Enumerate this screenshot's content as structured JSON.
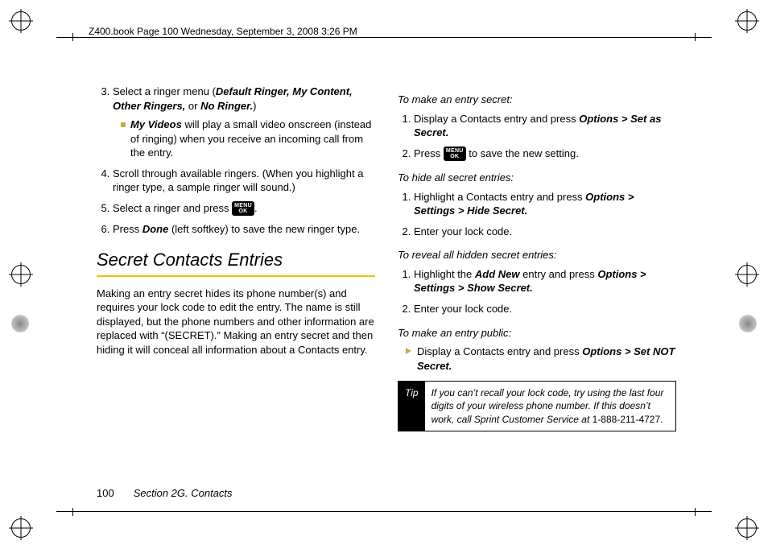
{
  "header": "Z400.book  Page 100  Wednesday, September 3, 2008  3:26 PM",
  "left": {
    "item3_lead": "Select a ringer menu (",
    "item3_opts": "Default Ringer, My Content, Other Ringers,",
    "item3_or": " or ",
    "item3_last": "No Ringer.",
    "item3_close": ")",
    "item3_sub_bold": "My Videos",
    "item3_sub_rest": " will play a small video onscreen (instead of ringing) when you receive an incoming call from the entry.",
    "item4": "Scroll through available ringers. (When you highlight a ringer type, a sample ringer will sound.)",
    "item5_a": "Select a ringer and press ",
    "item5_b": ".",
    "item6_a": "Press ",
    "item6_done": "Done",
    "item6_b": " (left softkey) to save the new ringer type.",
    "heading": "Secret Contacts Entries",
    "intro": "Making an entry secret hides its phone number(s) and requires your lock code to edit the entry. The name is still displayed, but the phone numbers and other information are replaced with “(SECRET).” Making an entry secret and then hiding it will conceal all information about a Contacts entry."
  },
  "right": {
    "task1": "To make an entry secret:",
    "t1_s1_a": "Display a Contacts entry and press ",
    "t1_s1_b": "Options > Set as Secret.",
    "t1_s2_a": "Press ",
    "t1_s2_b": " to save the new setting.",
    "task2": "To hide all secret entries:",
    "t2_s1_a": "Highlight a Contacts entry and press ",
    "t2_s1_b": "Options > Settings > Hide Secret.",
    "t2_s2": "Enter your lock code.",
    "task3": "To reveal all hidden secret entries:",
    "t3_s1_a": "Highlight the ",
    "t3_s1_bold": "Add New",
    "t3_s1_b": " entry and press ",
    "t3_s1_c": "Options > Settings > Show Secret.",
    "t3_s2": "Enter your lock code.",
    "task4": "To make an entry public:",
    "t4_s1_a": "Display a Contacts entry and press ",
    "t4_s1_b": "Options > Set NOT Secret.",
    "tip_label": "Tip",
    "tip_body": "If you can’t recall your lock code, try using the last four digits of your wireless phone number. If this doesn’t work, call Sprint Customer Service at ",
    "tip_phone": "1-888-211-4727."
  },
  "menu_key": {
    "l1": "MENU",
    "l2": "OK"
  },
  "footer": {
    "page": "100",
    "section": "Section 2G. Contacts"
  }
}
